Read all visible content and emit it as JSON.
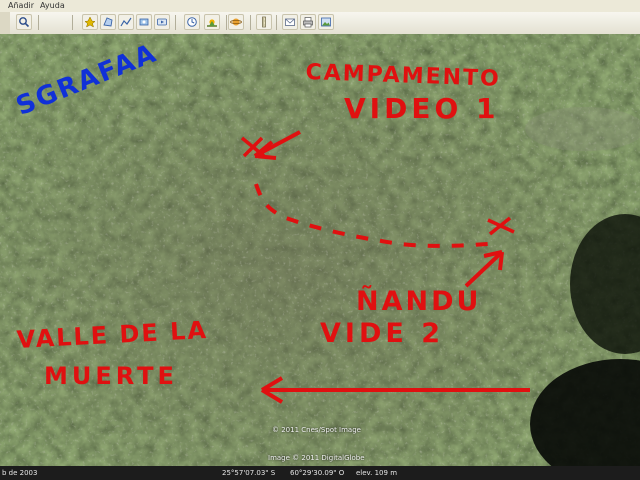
{
  "menu": {
    "items": [
      "Añadir",
      "Ayuda"
    ]
  },
  "toolbar": {
    "icons": [
      "search-icon",
      "placemark-icon",
      "polygon-icon",
      "path-icon",
      "overlay-icon",
      "tour-icon",
      "historical-imagery-icon",
      "sunlight-icon",
      "planets-icon",
      "ruler-icon",
      "email-icon",
      "print-icon",
      "save-image-icon"
    ]
  },
  "map": {
    "annotations": {
      "top_left": "SGRAFAA",
      "camp_line1": "CAMPAMENTO",
      "camp_line2": "VIDEO 1",
      "nandu_line1": "ÑANDU",
      "nandu_line2": "VIDE 2",
      "valle_line1": "VALLE DE LA",
      "valle_line2": "MUERTE"
    },
    "credits": {
      "copyright1": "© 2011 Cnes/Spot Image",
      "copyright2": "Image © 2011 DigitalGlobe"
    },
    "colors": {
      "annotation_red": "#e01010",
      "annotation_blue": "#1030d8"
    }
  },
  "status": {
    "date": "b de 2003",
    "latitude": "25°57'07.03\" S",
    "longitude": "60°29'30.09\" O",
    "elevation": "elev.  109 m"
  }
}
